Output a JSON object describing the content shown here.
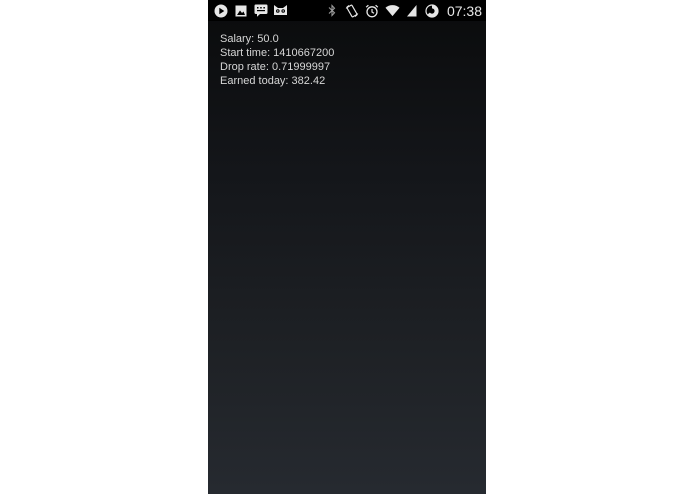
{
  "status_bar": {
    "time": "07:38",
    "notification_icons": [
      "play-store-icon",
      "gallery-icon",
      "sms-icon",
      "cat-icon"
    ],
    "system_icons": [
      "bluetooth-icon",
      "rotate-icon",
      "alarm-icon",
      "wifi-icon",
      "signal-icon",
      "battery-icon"
    ]
  },
  "app": {
    "lines": [
      {
        "label": "Salary",
        "value": "50.0",
        "text": "Salary: 50.0"
      },
      {
        "label": "Start time",
        "value": "1410667200",
        "text": "Start time: 1410667200"
      },
      {
        "label": "Drop rate",
        "value": "0.71999997",
        "text": "Drop rate: 0.71999997"
      },
      {
        "label": "Earned today",
        "value": "382.42",
        "text": "Earned today: 382.42"
      }
    ]
  },
  "colors": {
    "status_bar": "#000000",
    "text": "#d6d6d6",
    "background_top": "#0a0b0c",
    "background_bottom": "#262a30"
  }
}
